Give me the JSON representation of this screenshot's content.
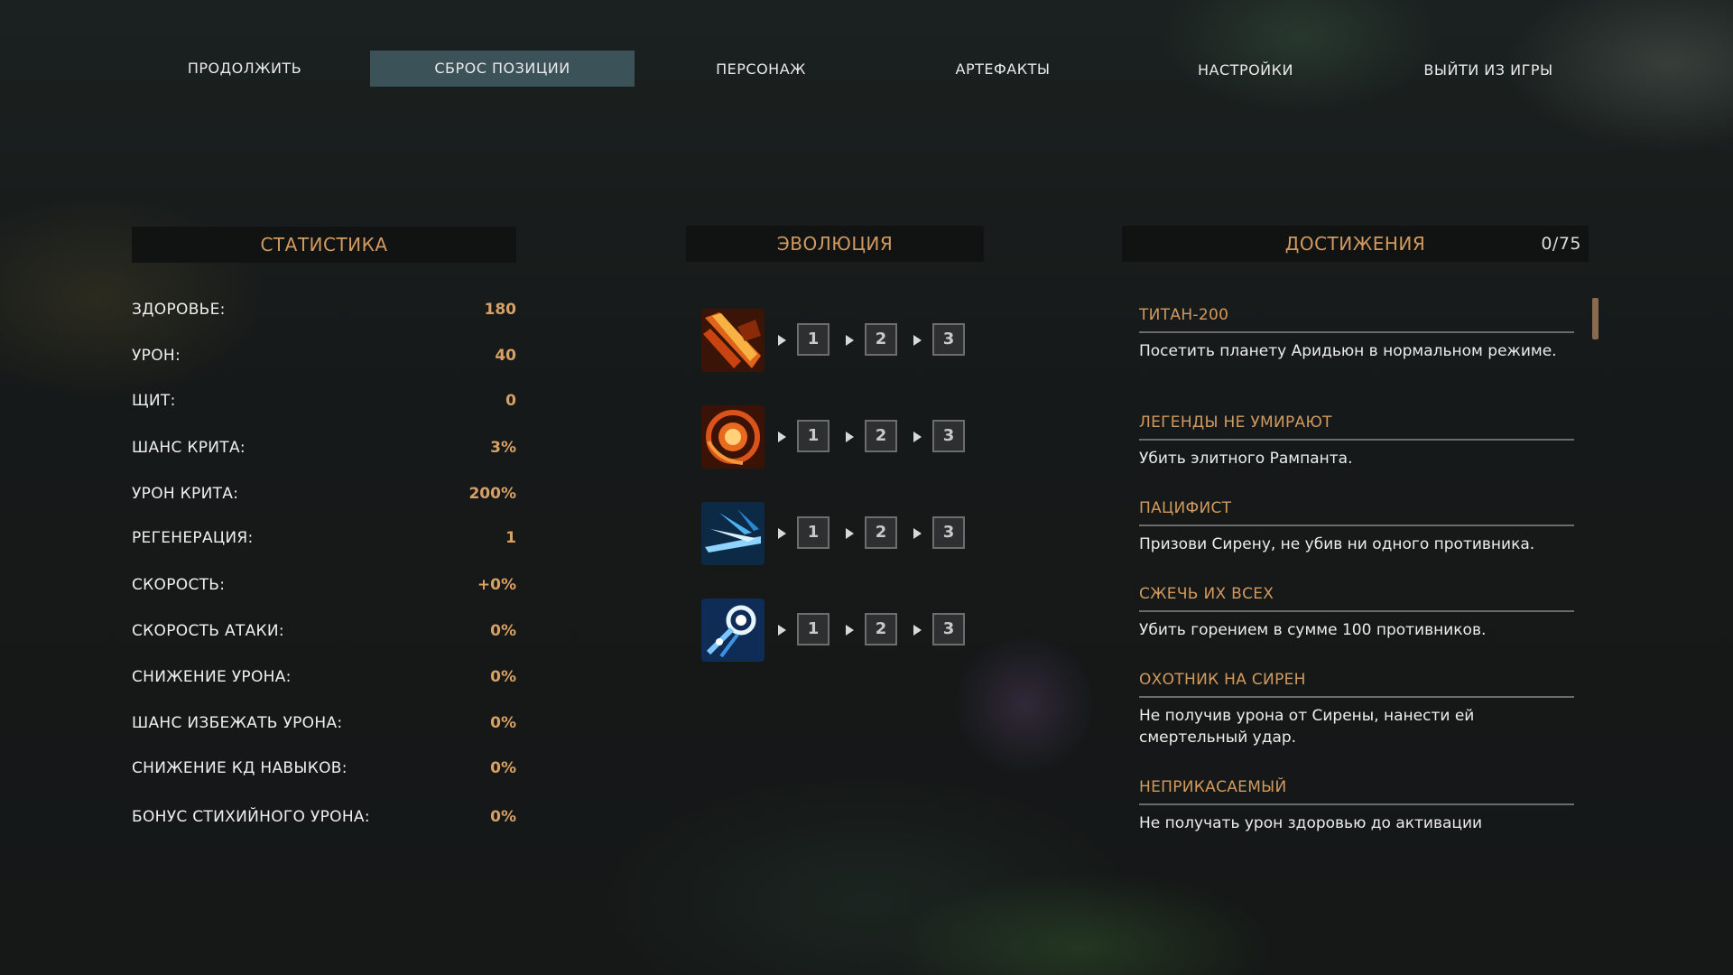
{
  "menu": {
    "continue": "ПРОДОЛЖИТЬ",
    "reset_position": "СБРОС ПОЗИЦИИ",
    "character": "ПЕРСОНАЖ",
    "artifacts": "АРТЕФАКТЫ",
    "settings": "НАСТРОЙКИ",
    "quit": "ВЫЙТИ ИЗ ИГРЫ",
    "active": "СБРОС ПОЗИЦИИ"
  },
  "stats": {
    "title": "СТАТИСТИКА",
    "rows": [
      {
        "label": "ЗДОРОВЬЕ:",
        "value": "180"
      },
      {
        "label": "УРОН:",
        "value": "40"
      },
      {
        "label": "ЩИТ:",
        "value": "0"
      },
      {
        "label": "ШАНС КРИТА:",
        "value": "3%"
      },
      {
        "label": "УРОН КРИТА:",
        "value": "200%"
      },
      {
        "label": "РЕГЕНЕРАЦИЯ:",
        "value": "1"
      },
      {
        "label": "СКОРОСТЬ:",
        "value": "+0%"
      },
      {
        "label": "СКОРОСТЬ АТАКИ:",
        "value": "0%"
      },
      {
        "label": "СНИЖЕНИЕ УРОНА:",
        "value": "0%"
      },
      {
        "label": "ШАНС ИЗБЕЖАТЬ УРОНА:",
        "value": "0%"
      },
      {
        "label": "СНИЖЕНИЕ КД НАВЫКОВ:",
        "value": "0%"
      },
      {
        "label": "БОНУС СТИХИЙНОГО УРОНА:",
        "value": "0%"
      }
    ]
  },
  "evolution": {
    "title": "ЭВОЛЮЦИЯ",
    "levels": [
      "1",
      "2",
      "3"
    ],
    "skills": [
      {
        "icon": "slash-attack-icon"
      },
      {
        "icon": "fire-orb-icon"
      },
      {
        "icon": "ice-wave-icon"
      },
      {
        "icon": "comet-dash-icon"
      }
    ]
  },
  "achievements": {
    "title": "ДОСТИЖЕНИЯ",
    "count": "0/75",
    "items": [
      {
        "title": "ТИТАН-200",
        "desc": "Посетить планету Аридьюн в нормальном режиме."
      },
      {
        "title": "ЛЕГЕНДЫ НЕ УМИРАЮТ",
        "desc": "Убить элитного Рампанта."
      },
      {
        "title": "ПАЦИФИСТ",
        "desc": "Призови Сирену, не убив ни одного противника."
      },
      {
        "title": "СЖЕЧЬ ИХ ВСЕХ",
        "desc": "Убить горением в сумме 100 противников."
      },
      {
        "title": "ОХОТНИК НА СИРЕН",
        "desc": "Не получив урона от Сирены, нанести ей смертельный удар."
      },
      {
        "title": "НЕПРИКАСАЕМЫЙ",
        "desc": "Не получать урон здоровью до активации"
      }
    ]
  },
  "colors": {
    "accent": "#d29a5e",
    "active_tab": "#3b5259"
  }
}
